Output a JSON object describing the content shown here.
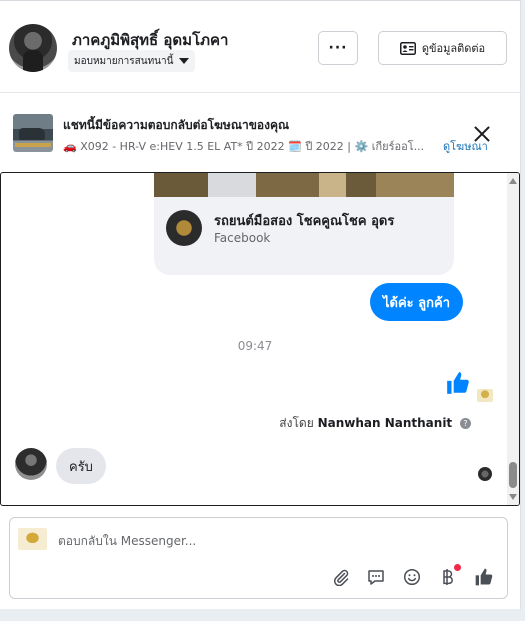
{
  "header": {
    "contact_name": "ภาคภูมิพิสุทธิ์ อุดมโภคา",
    "assign_label": "มอบหมายการสนทนานี้",
    "more_label": "···",
    "contact_info_label": "ดูข้อมูลติดต่อ"
  },
  "ad_banner": {
    "title": "แชทนี้มีข้อความตอบกลับต่อโฆษณาของคุณ",
    "subtitle": "🚗 X092 - HR-V e:HEV 1.5 EL AT* ปี 2022 🗓️ ปี 2022 | ⚙️ เกียร์ออโ...",
    "view_ad_label": "ดูโฆษณา"
  },
  "conversation": {
    "card": {
      "title": "รถยนต์มือสอง โชคคูณโชค อุดร",
      "source": "Facebook"
    },
    "outgoing_message": "ได้ค่ะ  ลูกค้า",
    "timestamp": "09:47",
    "sent_by_prefix": "ส่งโดย",
    "sent_by_name": "Nanwhan Nanthanit",
    "incoming_message": "ครับ"
  },
  "composer": {
    "placeholder": "ตอบกลับใน Messenger..."
  },
  "colors": {
    "messenger_blue": "#0084ff",
    "link_blue": "#1a73b8",
    "notification_red": "#f02849"
  }
}
